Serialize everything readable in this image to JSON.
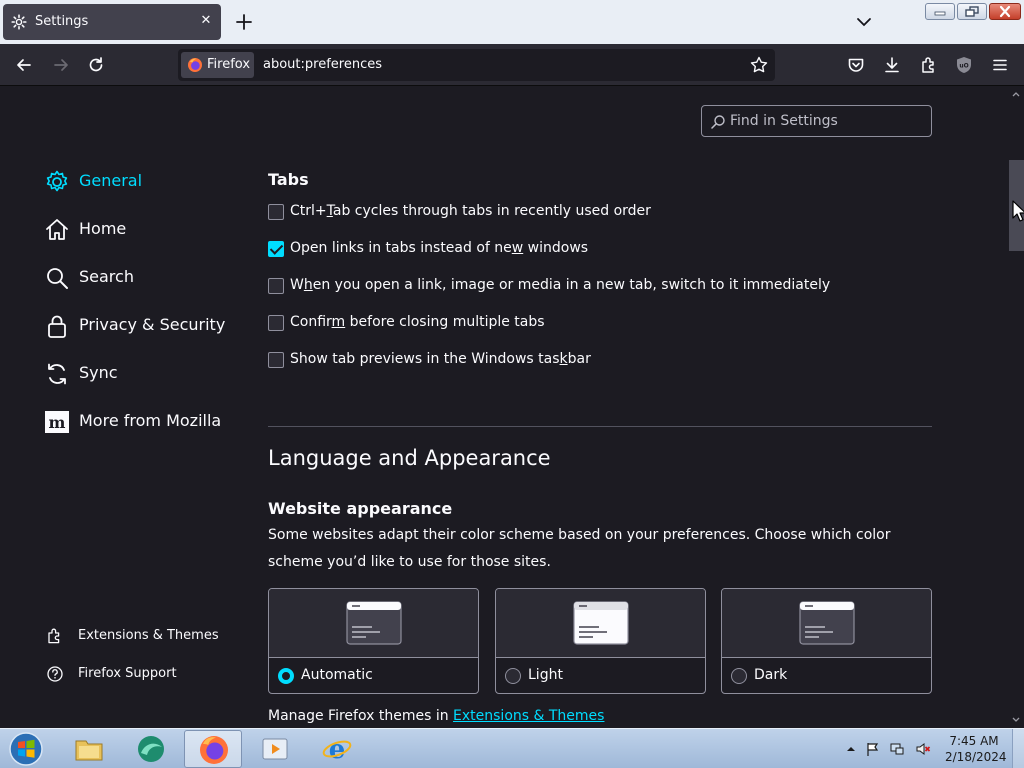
{
  "tab": {
    "title": "Settings",
    "close_symbol": "✕"
  },
  "urlbar": {
    "identity_label": "Firefox",
    "url": "about:preferences"
  },
  "search": {
    "placeholder": "Find in Settings",
    "value": ""
  },
  "sidebar": {
    "categories": [
      {
        "label": "General",
        "icon": "gear-icon",
        "selected": true
      },
      {
        "label": "Home",
        "icon": "home-icon",
        "selected": false
      },
      {
        "label": "Search",
        "icon": "search-icon",
        "selected": false
      },
      {
        "label": "Privacy & Security",
        "icon": "lock-icon",
        "selected": false
      },
      {
        "label": "Sync",
        "icon": "sync-icon",
        "selected": false
      },
      {
        "label": "More from Mozilla",
        "icon": "mozilla-icon",
        "selected": false
      }
    ],
    "footer_links": [
      {
        "label": "Extensions & Themes",
        "icon": "puzzle-icon"
      },
      {
        "label": "Firefox Support",
        "icon": "help-icon"
      }
    ]
  },
  "tabs_section": {
    "heading": "Tabs",
    "options": [
      {
        "pre": "Ctrl+",
        "u": "T",
        "post": "ab cycles through tabs in recently used order",
        "checked": false
      },
      {
        "pre": "Open links in tabs instead of ne",
        "u": "w",
        "post": " windows",
        "checked": true
      },
      {
        "pre": "W",
        "u": "h",
        "post": "en you open a link, image or media in a new tab, switch to it immediately",
        "checked": false
      },
      {
        "pre": "Confir",
        "u": "m",
        "post": " before closing multiple tabs",
        "checked": false
      },
      {
        "pre": "Show tab previews in the Windows tas",
        "u": "k",
        "post": "bar",
        "checked": false
      }
    ]
  },
  "appearance": {
    "heading": "Language and Appearance",
    "subheading": "Website appearance",
    "description": "Some websites adapt their color scheme based on your preferences. Choose which color scheme you’d like to use for those sites.",
    "themes": [
      {
        "label": "Automatic",
        "checked": true
      },
      {
        "label": "Light",
        "checked": false
      },
      {
        "label": "Dark",
        "checked": false
      }
    ],
    "manage_prefix": "Manage Firefox themes in ",
    "manage_link": "Extensions & Themes"
  },
  "taskbar": {
    "apps": [
      "file-explorer-icon",
      "browser-icon",
      "firefox-icon",
      "media-player-icon",
      "internet-explorer-icon"
    ],
    "active_app": "firefox-icon",
    "time": "7:45 AM",
    "date": "2/18/2024"
  },
  "colors": {
    "accent": "#00ddff",
    "page_bg": "#1c1b22",
    "toolbar_bg": "#2b2a33",
    "text": "#fbfbfe"
  }
}
